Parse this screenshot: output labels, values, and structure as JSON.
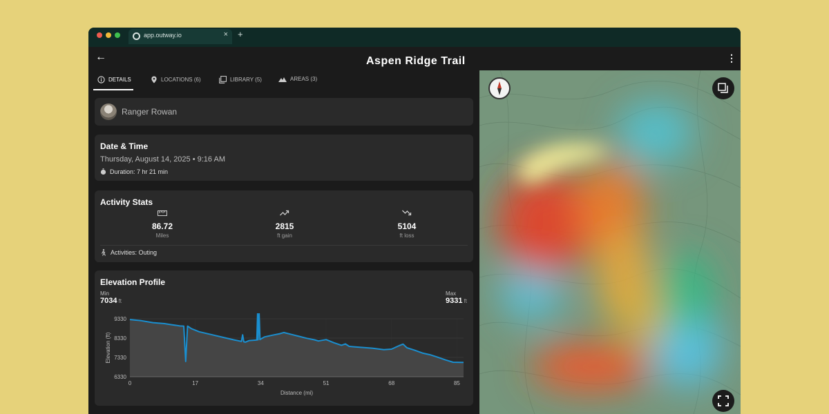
{
  "browser": {
    "tab_title": "app.outway.io",
    "close_glyph": "×",
    "new_tab_glyph": "+"
  },
  "header": {
    "title": "Aspen Ridge Trail",
    "back_icon": "←",
    "menu_icon": "⋮"
  },
  "tabs": [
    {
      "label": "DETAILS",
      "icon": "info-icon"
    },
    {
      "label": "LOCATIONS (6)",
      "icon": "pin-icon"
    },
    {
      "label": "LIBRARY (5)",
      "icon": "library-icon"
    },
    {
      "label": "AREAS (3)",
      "icon": "mountain-icon"
    }
  ],
  "user": {
    "name": "Ranger Rowan"
  },
  "datetime": {
    "title": "Date & Time",
    "date": "Thursday, August 14, 2025 • 9:16 AM",
    "duration": "Duration: 7 hr 21 min"
  },
  "stats": {
    "title": "Activity Stats",
    "items": [
      {
        "value": "86.72",
        "label": "Miles",
        "icon": "ruler-icon"
      },
      {
        "value": "2815",
        "label": "ft gain",
        "icon": "trending-up-icon"
      },
      {
        "value": "5104",
        "label": "ft loss",
        "icon": "trending-down-icon"
      }
    ],
    "activities": "Activities: Outing"
  },
  "elevation": {
    "title": "Elevation Profile",
    "min_label": "Min",
    "min_value": "7034",
    "max_label": "Max",
    "max_value": "9331",
    "unit": "ft"
  },
  "chart_data": {
    "type": "area",
    "xlabel": "Distance (mi)",
    "ylabel": "Elevation (ft)",
    "x_ticks": [
      0,
      17,
      34,
      51,
      68,
      85
    ],
    "y_ticks": [
      6330,
      7330,
      8330,
      9330
    ],
    "xlim": [
      0,
      86.72
    ],
    "ylim": [
      6330,
      9330
    ],
    "grid": true,
    "color": "#1a8fd0",
    "series": [
      {
        "x": [
          0,
          3,
          6,
          9,
          11,
          13,
          14,
          14.5,
          15,
          16,
          18,
          21,
          24,
          27,
          29,
          29.3,
          29.6,
          30,
          31,
          33,
          33.2,
          33.3,
          33.6,
          33.8,
          34,
          35,
          37,
          39,
          40,
          42,
          44,
          46,
          48,
          49,
          51,
          53,
          55,
          56,
          57,
          60,
          63,
          66,
          68,
          70,
          71,
          72,
          74,
          76,
          78,
          80,
          82,
          84,
          86.72
        ],
        "y": [
          9290,
          9230,
          9130,
          9080,
          9020,
          8960,
          8950,
          7120,
          8950,
          8820,
          8660,
          8520,
          8380,
          8240,
          8160,
          8500,
          8140,
          8120,
          8200,
          8230,
          10600,
          8240,
          10600,
          8250,
          8280,
          8390,
          8480,
          8560,
          8620,
          8520,
          8420,
          8320,
          8240,
          8180,
          8250,
          8090,
          7960,
          8030,
          7900,
          7850,
          7810,
          7730,
          7760,
          7940,
          8020,
          7830,
          7700,
          7560,
          7470,
          7340,
          7200,
          7080,
          7070
        ]
      }
    ]
  },
  "map": {
    "compass_icon": "compass-icon",
    "layers_icon": "layers-icon",
    "fullscreen_icon": "fullscreen-icon"
  },
  "colors": {
    "background": "#e6d27a",
    "app_bg": "#1b1b1b",
    "card_bg": "#2a2a2a",
    "accent": "#1a8fd0"
  }
}
